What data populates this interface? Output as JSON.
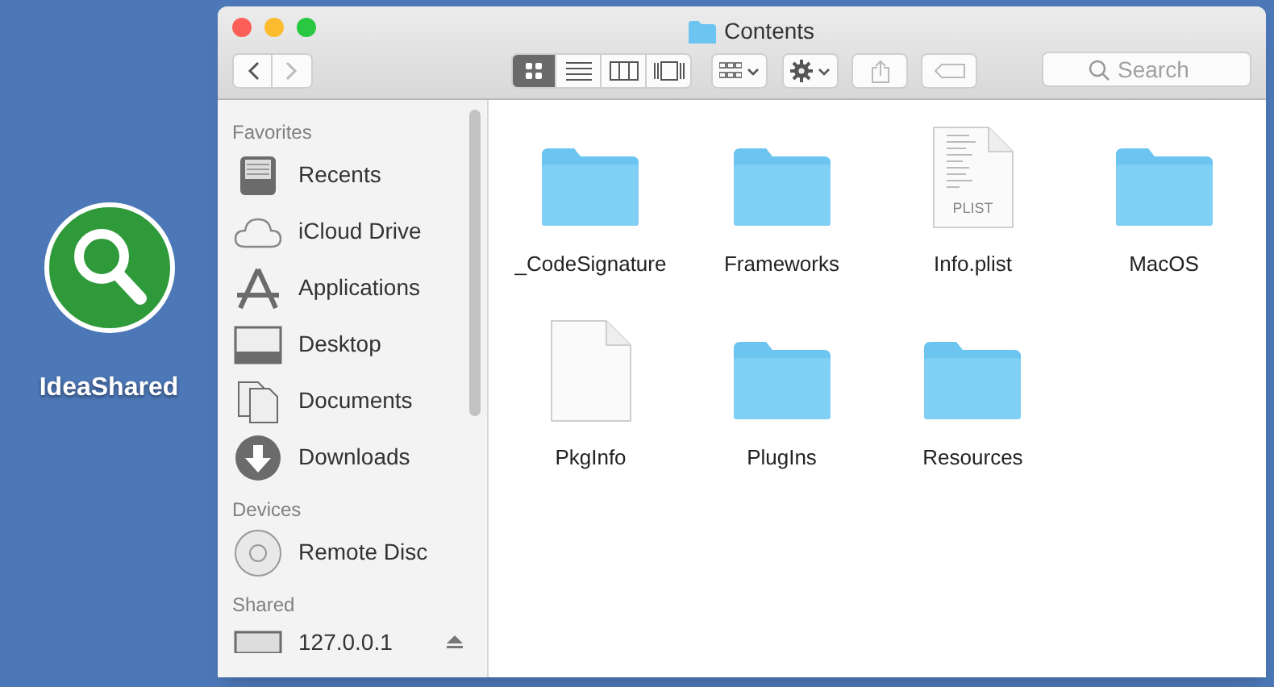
{
  "desktop_icon": {
    "label": "IdeaShared"
  },
  "window": {
    "title": "Contents"
  },
  "toolbar": {
    "view_modes": [
      {
        "selected": true
      },
      {
        "selected": false
      },
      {
        "selected": false
      },
      {
        "selected": false
      }
    ],
    "search": {
      "placeholder": "Search"
    }
  },
  "sidebar": {
    "sections": [
      {
        "title": "Favorites",
        "items": [
          {
            "label": "Recents"
          },
          {
            "label": "iCloud Drive"
          },
          {
            "label": "Applications"
          },
          {
            "label": "Desktop"
          },
          {
            "label": "Documents"
          },
          {
            "label": "Downloads"
          }
        ]
      },
      {
        "title": "Devices",
        "items": [
          {
            "label": "Remote Disc"
          }
        ]
      },
      {
        "title": "Shared",
        "items": [
          {
            "label": "127.0.0.1"
          }
        ]
      }
    ]
  },
  "files": [
    {
      "name": "_CodeSignature",
      "kind": "folder"
    },
    {
      "name": "Frameworks",
      "kind": "folder"
    },
    {
      "name": "Info.plist",
      "kind": "plist",
      "badge": "PLIST"
    },
    {
      "name": "MacOS",
      "kind": "folder"
    },
    {
      "name": "PkgInfo",
      "kind": "document"
    },
    {
      "name": "PlugIns",
      "kind": "folder"
    },
    {
      "name": "Resources",
      "kind": "folder"
    }
  ]
}
